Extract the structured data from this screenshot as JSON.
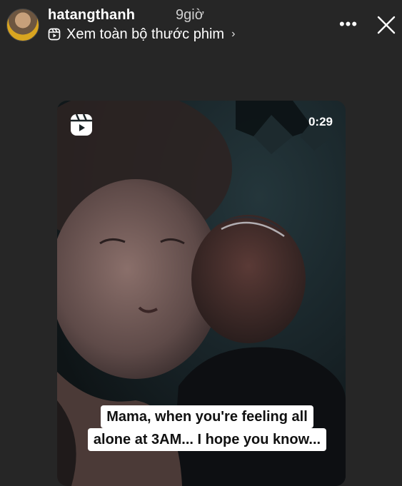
{
  "header": {
    "username": "hatangthanh",
    "timestamp": "9giờ",
    "reels_link_label": "Xem toàn bộ thước phim",
    "reels_link_chevron": "›",
    "more_label": "•••",
    "icons": {
      "avatar": "avatar",
      "reels": "reels-icon",
      "chevron": "chevron-right-icon",
      "more": "more-icon",
      "close": "close-icon"
    }
  },
  "reel": {
    "duration": "0:29",
    "caption_lines": [
      "Mama, when you're feeling all",
      "alone at 3AM... I hope you know..."
    ]
  },
  "colors": {
    "background": "#262626",
    "caption_bg": "#ffffff",
    "caption_text": "#111111"
  }
}
